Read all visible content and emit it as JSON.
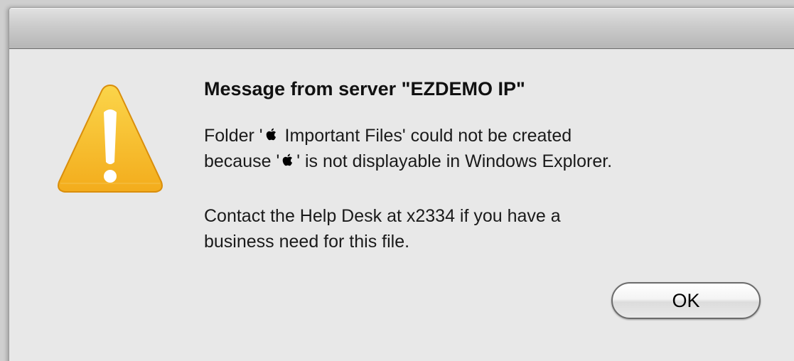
{
  "dialog": {
    "title": "Message from server \"EZDEMO IP\"",
    "message": {
      "line1_prefix": "Folder '",
      "line1_suffix": " Important Files' could not be created",
      "line2_prefix": "because '",
      "line2_suffix": "' is not displayable in Windows Explorer."
    },
    "help": {
      "line1": "Contact the Help Desk at x2334 if you have a",
      "line2": "business need for this file."
    },
    "ok_label": "OK",
    "icon": "warning-icon",
    "inline_symbol": "apple-logo-icon"
  },
  "colors": {
    "warning_yellow": "#f7c02c",
    "warning_yellow_dark": "#f0a515",
    "window_bg": "#e8e8e8"
  }
}
